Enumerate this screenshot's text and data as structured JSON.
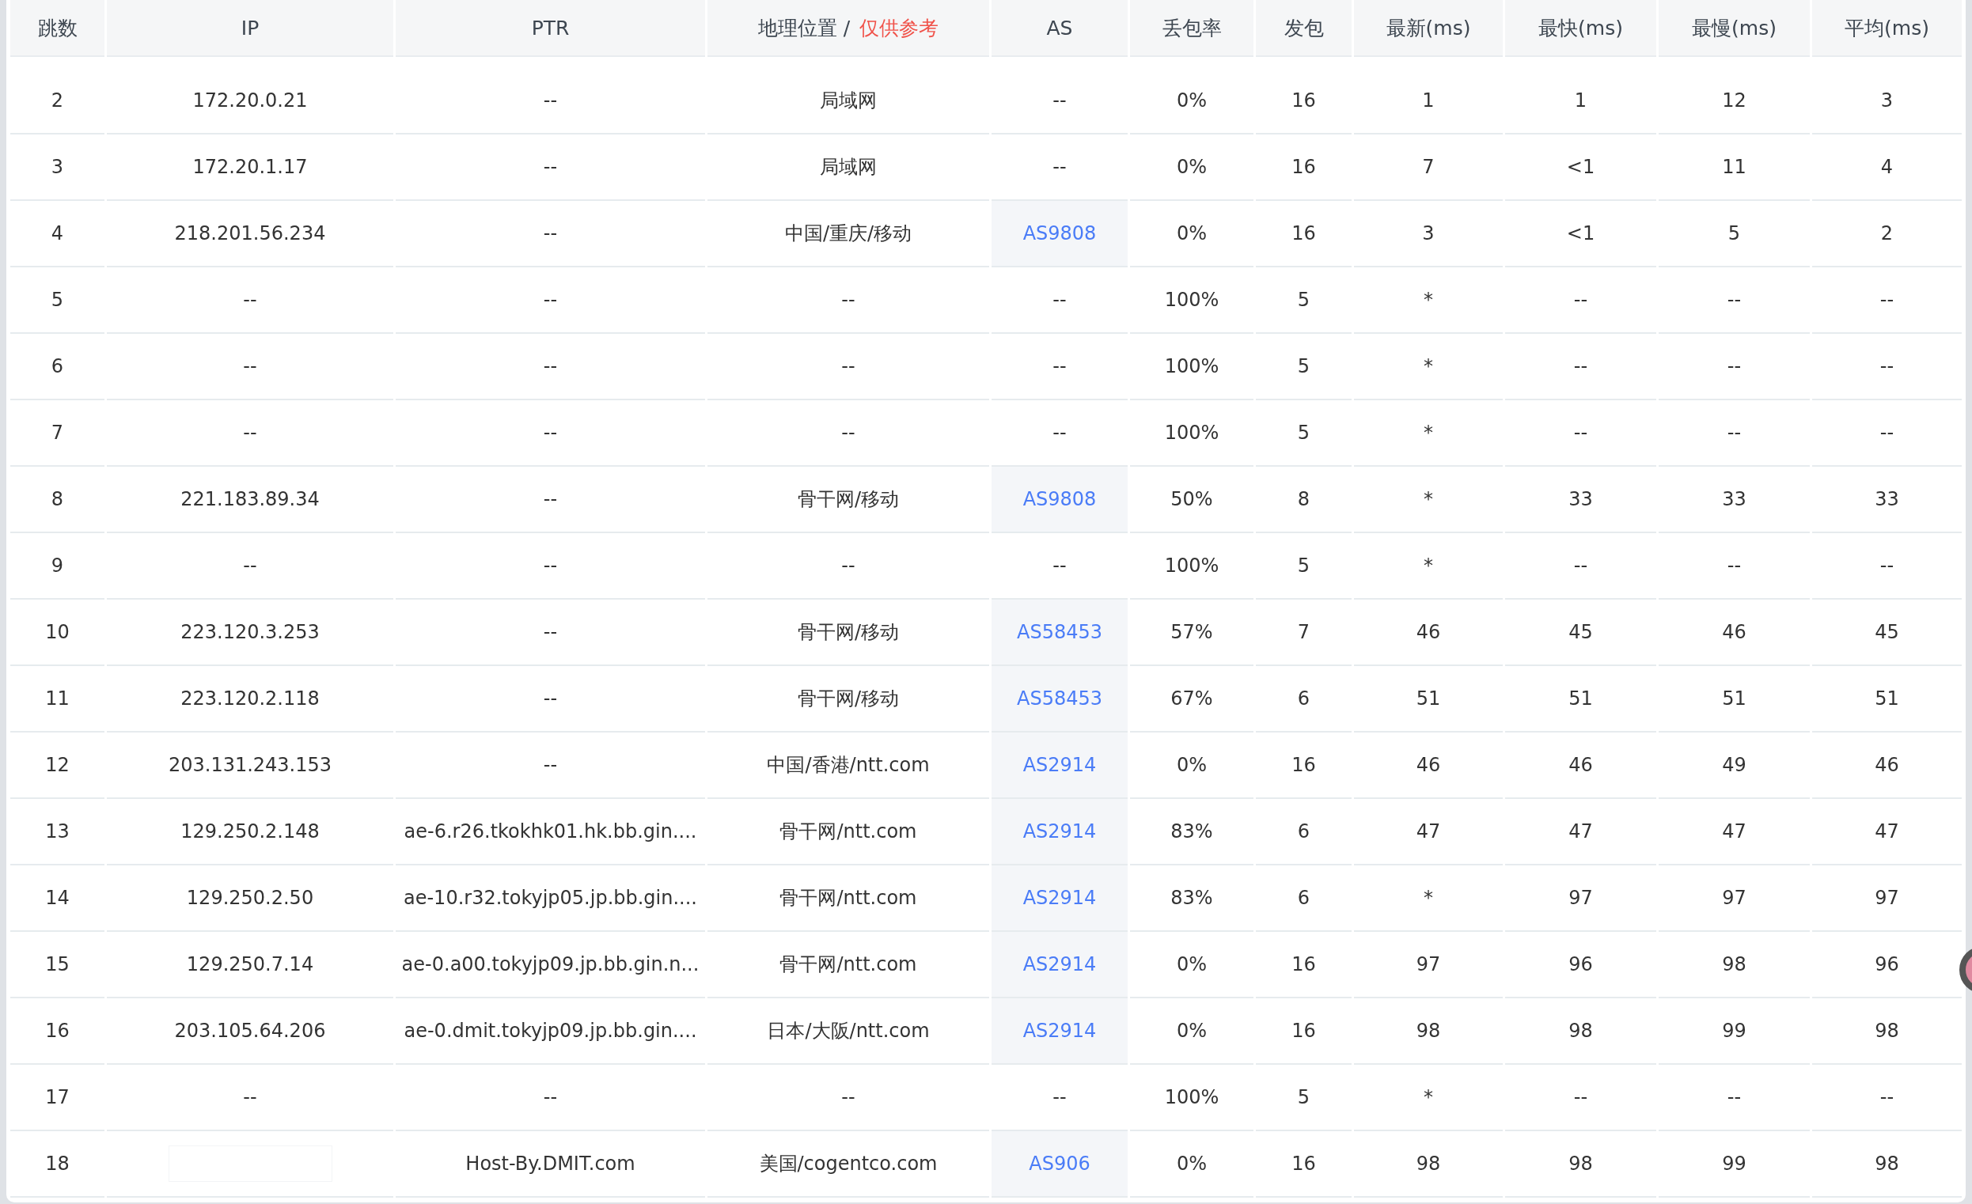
{
  "table": {
    "columns": [
      {
        "label": "跳数"
      },
      {
        "label": "IP"
      },
      {
        "label": "PTR"
      },
      {
        "label": "地理位置 / **仅供参考**"
      },
      {
        "label": "AS"
      },
      {
        "label": "丢包率"
      },
      {
        "label": "发包"
      },
      {
        "label": "最新(ms)"
      },
      {
        "label": "最快(ms)"
      },
      {
        "label": "最慢(ms)"
      },
      {
        "label": "平均(ms)"
      }
    ],
    "rows": [
      {
        "hop": "2",
        "ip": "172.20.0.21",
        "ptr": "--",
        "geo": "局域网",
        "as": "--",
        "as_link": false,
        "loss": "0%",
        "sent": "16",
        "last": "1",
        "best": "1",
        "worst": "12",
        "avg": "3"
      },
      {
        "hop": "3",
        "ip": "172.20.1.17",
        "ptr": "--",
        "geo": "局域网",
        "as": "--",
        "as_link": false,
        "loss": "0%",
        "sent": "16",
        "last": "7",
        "best": "<1",
        "worst": "11",
        "avg": "4"
      },
      {
        "hop": "4",
        "ip": "218.201.56.234",
        "ptr": "--",
        "geo": "中国/重庆/移动",
        "as": "AS9808",
        "as_link": true,
        "loss": "0%",
        "sent": "16",
        "last": "3",
        "best": "<1",
        "worst": "5",
        "avg": "2"
      },
      {
        "hop": "5",
        "ip": "--",
        "ptr": "--",
        "geo": "--",
        "as": "--",
        "as_link": false,
        "loss": "100%",
        "sent": "5",
        "last": "*",
        "best": "--",
        "worst": "--",
        "avg": "--"
      },
      {
        "hop": "6",
        "ip": "--",
        "ptr": "--",
        "geo": "--",
        "as": "--",
        "as_link": false,
        "loss": "100%",
        "sent": "5",
        "last": "*",
        "best": "--",
        "worst": "--",
        "avg": "--"
      },
      {
        "hop": "7",
        "ip": "--",
        "ptr": "--",
        "geo": "--",
        "as": "--",
        "as_link": false,
        "loss": "100%",
        "sent": "5",
        "last": "*",
        "best": "--",
        "worst": "--",
        "avg": "--"
      },
      {
        "hop": "8",
        "ip": "221.183.89.34",
        "ptr": "--",
        "geo": "骨干网/移动",
        "as": "AS9808",
        "as_link": true,
        "loss": "50%",
        "sent": "8",
        "last": "*",
        "best": "33",
        "worst": "33",
        "avg": "33"
      },
      {
        "hop": "9",
        "ip": "--",
        "ptr": "--",
        "geo": "--",
        "as": "--",
        "as_link": false,
        "loss": "100%",
        "sent": "5",
        "last": "*",
        "best": "--",
        "worst": "--",
        "avg": "--"
      },
      {
        "hop": "10",
        "ip": "223.120.3.253",
        "ptr": "--",
        "geo": "骨干网/移动",
        "as": "AS58453",
        "as_link": true,
        "loss": "57%",
        "sent": "7",
        "last": "46",
        "best": "45",
        "worst": "46",
        "avg": "45"
      },
      {
        "hop": "11",
        "ip": "223.120.2.118",
        "ptr": "--",
        "geo": "骨干网/移动",
        "as": "AS58453",
        "as_link": true,
        "loss": "67%",
        "sent": "6",
        "last": "51",
        "best": "51",
        "worst": "51",
        "avg": "51"
      },
      {
        "hop": "12",
        "ip": "203.131.243.153",
        "ptr": "--",
        "geo": "中国/香港/ntt.com",
        "as": "AS2914",
        "as_link": true,
        "loss": "0%",
        "sent": "16",
        "last": "46",
        "best": "46",
        "worst": "49",
        "avg": "46"
      },
      {
        "hop": "13",
        "ip": "129.250.2.148",
        "ptr": "ae-6.r26.tkokhk01.hk.bb.gin....",
        "geo": "骨干网/ntt.com",
        "as": "AS2914",
        "as_link": true,
        "loss": "83%",
        "sent": "6",
        "last": "47",
        "best": "47",
        "worst": "47",
        "avg": "47"
      },
      {
        "hop": "14",
        "ip": "129.250.2.50",
        "ptr": "ae-10.r32.tokyjp05.jp.bb.gin....",
        "geo": "骨干网/ntt.com",
        "as": "AS2914",
        "as_link": true,
        "loss": "83%",
        "sent": "6",
        "last": "*",
        "best": "97",
        "worst": "97",
        "avg": "97"
      },
      {
        "hop": "15",
        "ip": "129.250.7.14",
        "ptr": "ae-0.a00.tokyjp09.jp.bb.gin.n...",
        "geo": "骨干网/ntt.com",
        "as": "AS2914",
        "as_link": true,
        "loss": "0%",
        "sent": "16",
        "last": "97",
        "best": "96",
        "worst": "98",
        "avg": "96"
      },
      {
        "hop": "16",
        "ip": "203.105.64.206",
        "ptr": "ae-0.dmit.tokyjp09.jp.bb.gin....",
        "geo": "日本/大阪/ntt.com",
        "as": "AS2914",
        "as_link": true,
        "loss": "0%",
        "sent": "16",
        "last": "98",
        "best": "98",
        "worst": "99",
        "avg": "98"
      },
      {
        "hop": "17",
        "ip": "--",
        "ptr": "--",
        "geo": "--",
        "as": "--",
        "as_link": false,
        "loss": "100%",
        "sent": "5",
        "last": "*",
        "best": "--",
        "worst": "--",
        "avg": "--"
      },
      {
        "hop": "18",
        "ip_redacted": true,
        "ptr": "Host-By.DMIT.com",
        "geo": "美国/cogentco.com",
        "as": "AS906",
        "as_link": true,
        "loss": "0%",
        "sent": "16",
        "last": "98",
        "best": "98",
        "worst": "99",
        "avg": "98"
      }
    ]
  }
}
